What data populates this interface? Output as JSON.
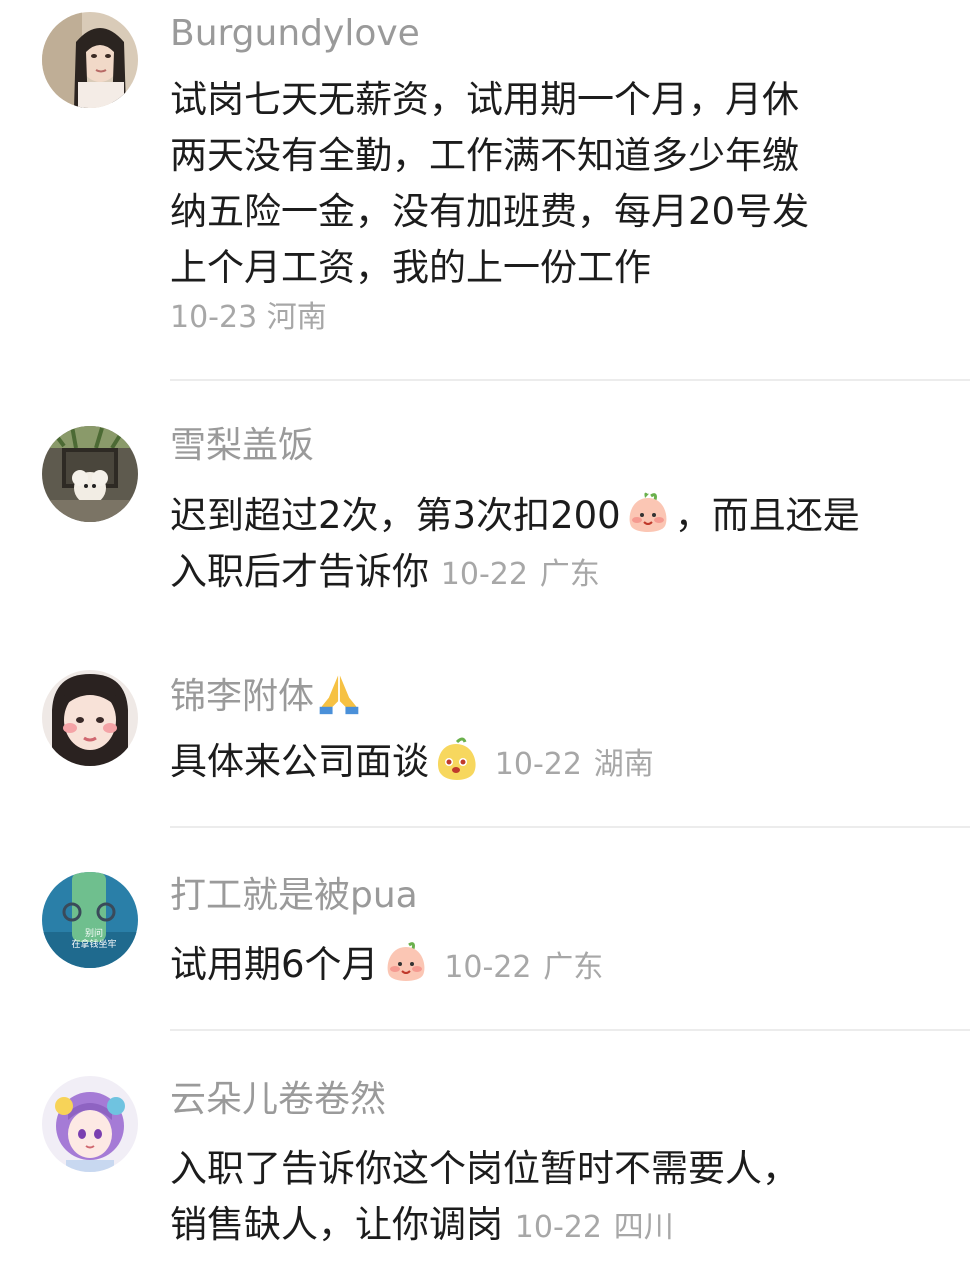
{
  "comments": [
    {
      "username": "Burgundylove",
      "lines": [
        "试岗七天无薪资，试用期一个月，月休",
        "两天没有全勤，工作满不知道多少年缴",
        "纳五险一金，没有加班费，每月20号发",
        "上个月工资，我的上一份工作"
      ],
      "date": "10-23",
      "location": "河南"
    },
    {
      "username": "雪梨盖饭",
      "text_a": "迟到超过2次，第3次扣200",
      "text_b": "，而且还是",
      "text_c": "入职后才告诉你",
      "emoji": "peach-face-emoji",
      "date": "10-22",
      "location": "广东"
    },
    {
      "username": "锦李附体",
      "username_emoji": "folded-hands-emoji",
      "text": "具体来公司面谈",
      "emoji": "mango-face-emoji",
      "date": "10-22",
      "location": "湖南"
    },
    {
      "username": "打工就是被pua",
      "text": "试用期6个月",
      "emoji": "peach-face-emoji",
      "date": "10-22",
      "location": "广东",
      "avatar_text": [
        "别问",
        "在拿钱坐牢"
      ]
    },
    {
      "username": "云朵儿卷卷然",
      "line1": "入职了告诉你这个岗位暂时不需要人，",
      "line2": "销售缺人，让你调岗",
      "date": "10-22",
      "location": "四川"
    }
  ]
}
